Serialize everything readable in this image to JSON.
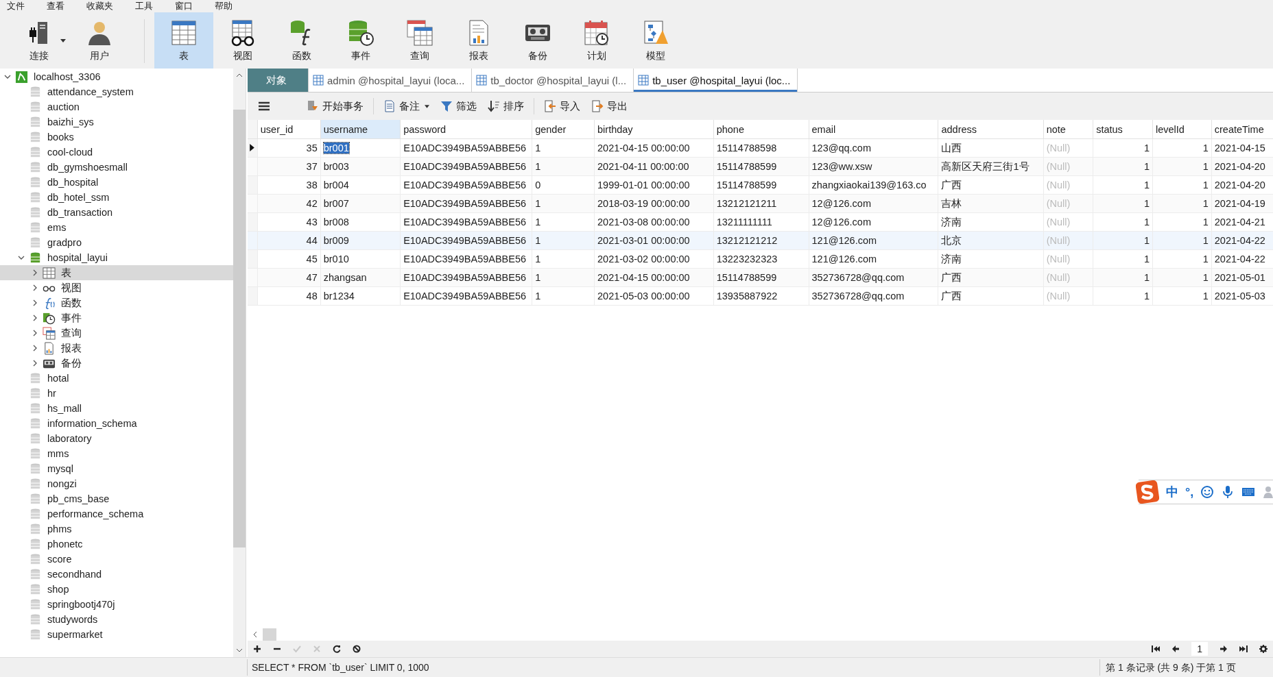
{
  "menu": [
    "文件",
    "查看",
    "收藏夹",
    "工具",
    "窗口",
    "帮助"
  ],
  "toolbar": [
    {
      "kind": "connection",
      "label": "连接",
      "dropdown": true,
      "selected": false
    },
    {
      "kind": "user",
      "label": "用户",
      "dropdown": false,
      "selected": false
    },
    {
      "kind": "table",
      "label": "表",
      "dropdown": false,
      "selected": true
    },
    {
      "kind": "view",
      "label": "视图",
      "dropdown": false,
      "selected": false
    },
    {
      "kind": "function",
      "label": "函数",
      "dropdown": false,
      "selected": false
    },
    {
      "kind": "event",
      "label": "事件",
      "dropdown": false,
      "selected": false
    },
    {
      "kind": "query",
      "label": "查询",
      "dropdown": false,
      "selected": false
    },
    {
      "kind": "report",
      "label": "报表",
      "dropdown": false,
      "selected": false
    },
    {
      "kind": "backup",
      "label": "备份",
      "dropdown": false,
      "selected": false
    },
    {
      "kind": "schedule",
      "label": "计划",
      "dropdown": false,
      "selected": false
    },
    {
      "kind": "model",
      "label": "模型",
      "dropdown": false,
      "selected": false
    }
  ],
  "tree": [
    {
      "kind": "server",
      "label": "localhost_3306",
      "expanded": true,
      "selected": false,
      "children": [
        {
          "kind": "database",
          "label": "attendance_system",
          "selected": false
        },
        {
          "kind": "database",
          "label": "auction",
          "selected": false
        },
        {
          "kind": "database",
          "label": "baizhi_sys",
          "selected": false
        },
        {
          "kind": "database",
          "label": "books",
          "selected": false
        },
        {
          "kind": "database",
          "label": "cool-cloud",
          "selected": false
        },
        {
          "kind": "database",
          "label": "db_gymshoesmall",
          "selected": false
        },
        {
          "kind": "database",
          "label": "db_hospital",
          "selected": false
        },
        {
          "kind": "database",
          "label": "db_hotel_ssm",
          "selected": false
        },
        {
          "kind": "database",
          "label": "db_transaction",
          "selected": false
        },
        {
          "kind": "database",
          "label": "ems",
          "selected": false
        },
        {
          "kind": "database",
          "label": "gradpro",
          "selected": false
        },
        {
          "kind": "database",
          "label": "hospital_layui",
          "expanded": true,
          "selected": false,
          "children": [
            {
              "kind": "tables",
              "label": "表",
              "expanded": false,
              "selected": true
            },
            {
              "kind": "views",
              "label": "视图",
              "expanded": false,
              "selected": false
            },
            {
              "kind": "functions",
              "label": "函数",
              "expanded": false,
              "selected": false
            },
            {
              "kind": "events",
              "label": "事件",
              "expanded": false,
              "selected": false
            },
            {
              "kind": "queries",
              "label": "查询",
              "expanded": false,
              "selected": false
            },
            {
              "kind": "reports",
              "label": "报表",
              "expanded": false,
              "selected": false
            },
            {
              "kind": "backups",
              "label": "备份",
              "expanded": false,
              "selected": false
            }
          ]
        },
        {
          "kind": "database",
          "label": "hotal",
          "selected": false
        },
        {
          "kind": "database",
          "label": "hr",
          "selected": false
        },
        {
          "kind": "database",
          "label": "hs_mall",
          "selected": false
        },
        {
          "kind": "database",
          "label": "information_schema",
          "selected": false
        },
        {
          "kind": "database",
          "label": "laboratory",
          "selected": false
        },
        {
          "kind": "database",
          "label": "mms",
          "selected": false
        },
        {
          "kind": "database",
          "label": "mysql",
          "selected": false
        },
        {
          "kind": "database",
          "label": "nongzi",
          "selected": false
        },
        {
          "kind": "database",
          "label": "pb_cms_base",
          "selected": false
        },
        {
          "kind": "database",
          "label": "performance_schema",
          "selected": false
        },
        {
          "kind": "database",
          "label": "phms",
          "selected": false
        },
        {
          "kind": "database",
          "label": "phonetc",
          "selected": false
        },
        {
          "kind": "database",
          "label": "score",
          "selected": false
        },
        {
          "kind": "database",
          "label": "secondhand",
          "selected": false
        },
        {
          "kind": "database",
          "label": "shop",
          "selected": false
        },
        {
          "kind": "database",
          "label": "springbootj470j",
          "selected": false
        },
        {
          "kind": "database",
          "label": "studywords",
          "selected": false
        },
        {
          "kind": "database",
          "label": "supermarket",
          "selected": false
        }
      ]
    }
  ],
  "tabs": [
    {
      "kind": "objects",
      "label": "对象",
      "selected": false
    },
    {
      "kind": "table",
      "label": "admin @hospital_layui (loca...",
      "selected": false
    },
    {
      "kind": "table",
      "label": "tb_doctor @hospital_layui (l...",
      "selected": false
    },
    {
      "kind": "table",
      "label": "tb_user @hospital_layui (loc...",
      "selected": true
    }
  ],
  "actions": [
    {
      "kind": "transaction",
      "label": "开始事务",
      "dropdown": false
    },
    {
      "kind": "note",
      "label": "备注",
      "dropdown": true
    },
    {
      "kind": "filter",
      "label": "筛选",
      "dropdown": false
    },
    {
      "kind": "sort",
      "label": "排序",
      "dropdown": false
    },
    {
      "kind": "import",
      "label": "导入",
      "dropdown": false
    },
    {
      "kind": "export",
      "label": "导出",
      "dropdown": false
    }
  ],
  "table": {
    "columns": [
      {
        "label": "user_id",
        "numeric": true,
        "muted": false,
        "selected": false
      },
      {
        "label": "username",
        "numeric": false,
        "muted": false,
        "selected": true
      },
      {
        "label": "password",
        "numeric": false,
        "muted": false,
        "selected": false
      },
      {
        "label": "gender",
        "numeric": false,
        "muted": false,
        "selected": false
      },
      {
        "label": "birthday",
        "numeric": false,
        "muted": false,
        "selected": false
      },
      {
        "label": "phone",
        "numeric": false,
        "muted": false,
        "selected": false
      },
      {
        "label": "email",
        "numeric": false,
        "muted": false,
        "selected": false
      },
      {
        "label": "address",
        "numeric": false,
        "muted": false,
        "selected": false
      },
      {
        "label": "note",
        "numeric": false,
        "muted": true,
        "selected": false
      },
      {
        "label": "status",
        "numeric": true,
        "muted": false,
        "selected": false
      },
      {
        "label": "levelId",
        "numeric": true,
        "muted": false,
        "selected": false
      },
      {
        "label": "createTime",
        "numeric": false,
        "muted": false,
        "selected": false
      }
    ],
    "rows": [
      {
        "current": true,
        "hovered": false,
        "cells": [
          "35",
          "br001",
          "E10ADC3949BA59ABBE56",
          "1",
          "2021-04-15 00:00:00",
          "15114788598",
          "123@qq.com",
          "山西",
          "(Null)",
          "1",
          "1",
          "2021-04-15"
        ]
      },
      {
        "current": false,
        "hovered": false,
        "cells": [
          "37",
          "br003",
          "E10ADC3949BA59ABBE56",
          "1",
          "2021-04-11 00:00:00",
          "15114788599",
          "123@ww.xsw",
          "高新区天府三街1号",
          "(Null)",
          "1",
          "1",
          "2021-04-20"
        ]
      },
      {
        "current": false,
        "hovered": false,
        "cells": [
          "38",
          "br004",
          "E10ADC3949BA59ABBE56",
          "0",
          "1999-01-01 00:00:00",
          "15114788599",
          "zhangxiaokai139@163.co",
          "广西",
          "(Null)",
          "1",
          "1",
          "2021-04-20"
        ]
      },
      {
        "current": false,
        "hovered": false,
        "cells": [
          "42",
          "br007",
          "E10ADC3949BA59ABBE56",
          "1",
          "2018-03-19 00:00:00",
          "13212121211",
          "12@126.com",
          "吉林",
          "(Null)",
          "1",
          "1",
          "2021-04-19"
        ]
      },
      {
        "current": false,
        "hovered": false,
        "cells": [
          "43",
          "br008",
          "E10ADC3949BA59ABBE56",
          "1",
          "2021-03-08 00:00:00",
          "13211111111",
          "12@126.com",
          "济南",
          "(Null)",
          "1",
          "1",
          "2021-04-21"
        ]
      },
      {
        "current": false,
        "hovered": true,
        "cells": [
          "44",
          "br009",
          "E10ADC3949BA59ABBE56",
          "1",
          "2021-03-01 00:00:00",
          "13212121212",
          "121@126.com",
          "北京",
          "(Null)",
          "1",
          "1",
          "2021-04-22"
        ]
      },
      {
        "current": false,
        "hovered": false,
        "cells": [
          "45",
          "br010",
          "E10ADC3949BA59ABBE56",
          "1",
          "2021-03-02 00:00:00",
          "13223232323",
          "121@126.com",
          "济南",
          "(Null)",
          "1",
          "1",
          "2021-04-22"
        ]
      },
      {
        "current": false,
        "hovered": false,
        "cells": [
          "47",
          "zhangsan",
          "E10ADC3949BA59ABBE56",
          "1",
          "2021-04-15 00:00:00",
          "15114788599",
          "352736728@qq.com",
          "广西",
          "(Null)",
          "1",
          "1",
          "2021-05-01"
        ]
      },
      {
        "current": false,
        "hovered": false,
        "cells": [
          "48",
          "br1234",
          "E10ADC3949BA59ABBE56",
          "1",
          "2021-05-03 00:00:00",
          "13935887922",
          "352736728@qq.com",
          "广西",
          "(Null)",
          "1",
          "1",
          "2021-05-03"
        ]
      }
    ]
  },
  "pager": {
    "page": "1"
  },
  "status_bar": {
    "query": "SELECT * FROM `tb_user` LIMIT 0, 1000",
    "records": "第 1 条记录 (共 9 条) 于第 1 页"
  },
  "ime": {
    "mode": "中",
    "punctuation": "°,"
  }
}
